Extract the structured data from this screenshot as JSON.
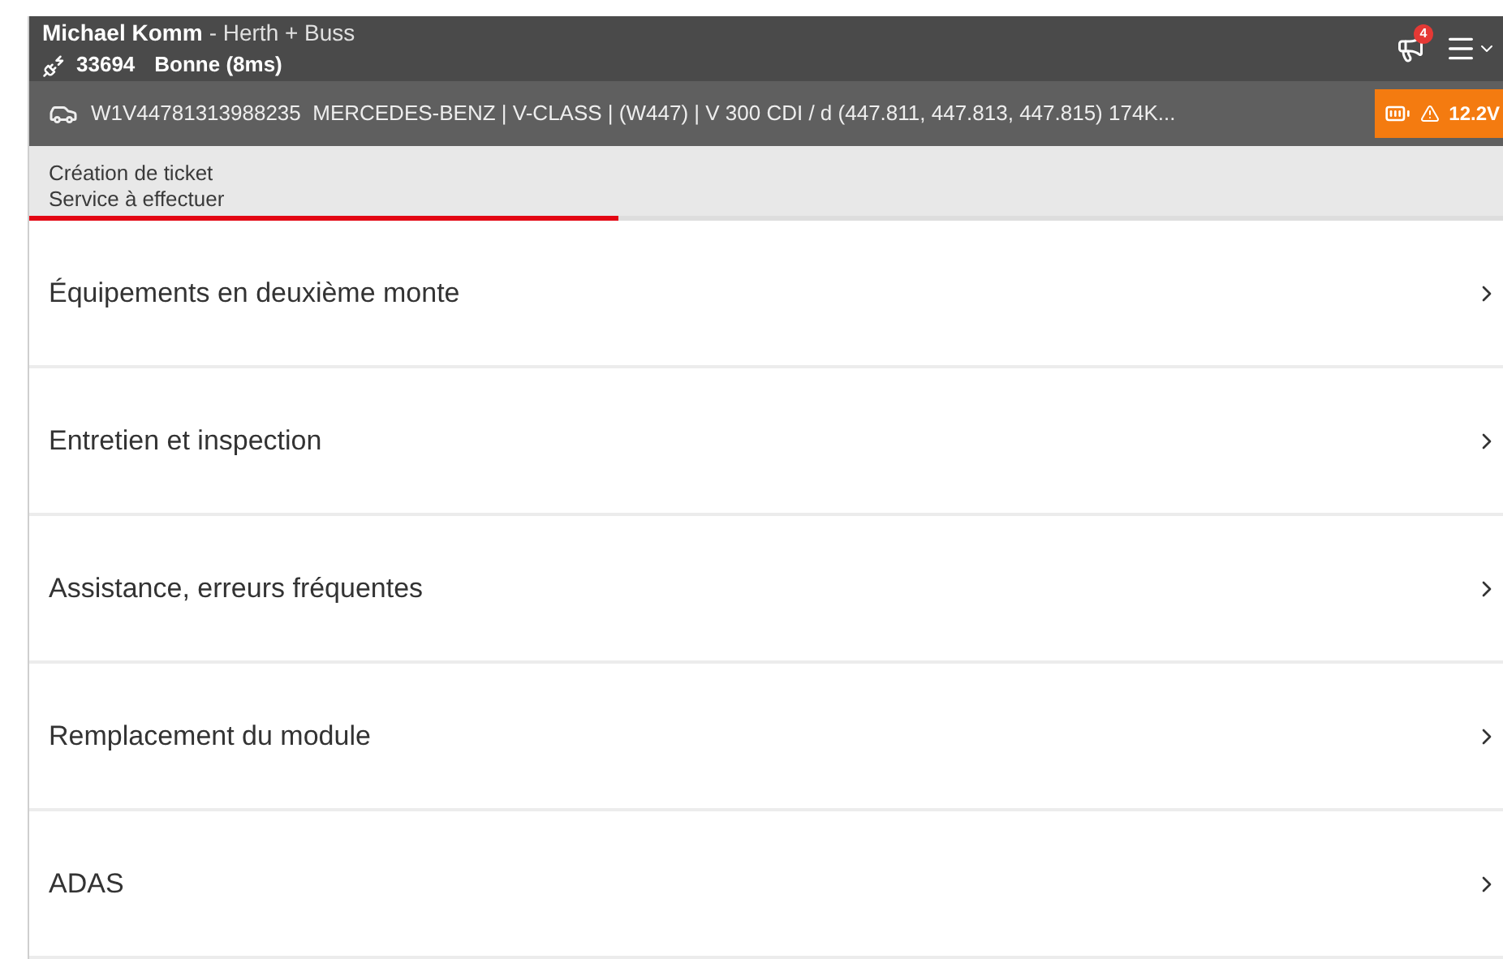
{
  "header": {
    "user_name": "Michael Komm",
    "company": "- Herth + Buss",
    "device_id": "33694",
    "connection": "Bonne (8ms)",
    "notification_count": "4"
  },
  "vehicle_bar": {
    "description": "W1V44781313988235  MERCEDES-BENZ | V-CLASS | (W447) | V 300 CDI / d (447.811, 447.813, 447.815) 174K...",
    "battery_reading": "12.2V"
  },
  "ticket": {
    "title": "Création de ticket",
    "subtitle": "Service à effectuer",
    "level": 0.4
  },
  "menu_items": [
    {
      "label": "Équipements en deuxième monte"
    },
    {
      "label": "Entretien et inspection"
    },
    {
      "label": "Assistance, erreurs fréquentes"
    },
    {
      "label": "Remplacement du module"
    },
    {
      "label": "ADAS"
    }
  ]
}
